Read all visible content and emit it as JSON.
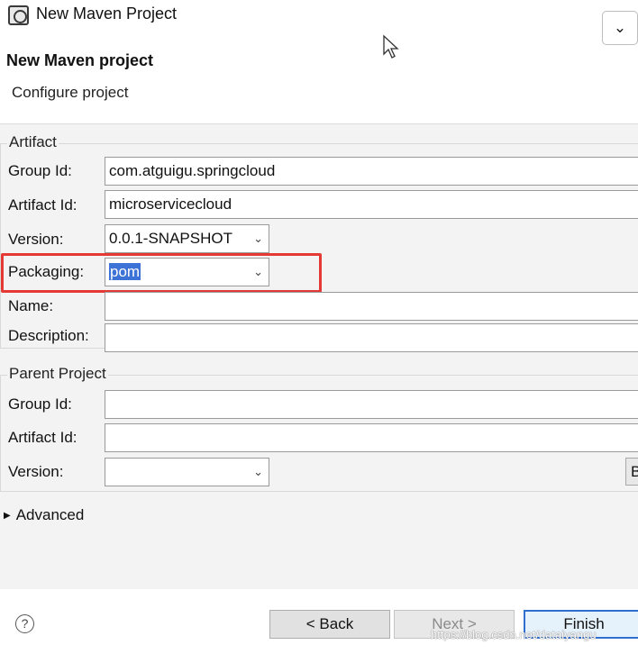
{
  "window": {
    "title": "New Maven Project"
  },
  "header": {
    "title": "New Maven project",
    "subtitle": "Configure project"
  },
  "artifact": {
    "group_label": "Artifact",
    "group_id_label": "Group Id:",
    "group_id_value": "com.atguigu.springcloud",
    "artifact_id_label": "Artifact Id:",
    "artifact_id_value": "microservicecloud",
    "version_label": "Version:",
    "version_value": "0.0.1-SNAPSHOT",
    "packaging_label": "Packaging:",
    "packaging_value": "pom",
    "name_label": "Name:",
    "name_value": "",
    "description_label": "Description:",
    "description_value": ""
  },
  "parent": {
    "group_label": "Parent Project",
    "group_id_label": "Group Id:",
    "group_id_value": "",
    "artifact_id_label": "Artifact Id:",
    "artifact_id_value": "",
    "version_label": "Version:",
    "version_value": "",
    "browse_label": "B"
  },
  "advanced": {
    "label": "Advanced"
  },
  "footer": {
    "help_label": "?",
    "back_label": "< Back",
    "next_label": "Next >",
    "finish_label": "Finish"
  },
  "watermark": "https://blog.csdn.net/dataiyangu",
  "colors": {
    "highlight_box": "#e53935",
    "selection": "#3d73d6",
    "default_button_border": "#2f6fd0"
  },
  "icons": {
    "app": "maven-app-icon",
    "menu": "chevron-down-icon",
    "cursor": "mouse-cursor-icon",
    "help": "help-icon",
    "advanced": "triangle-right-icon"
  }
}
